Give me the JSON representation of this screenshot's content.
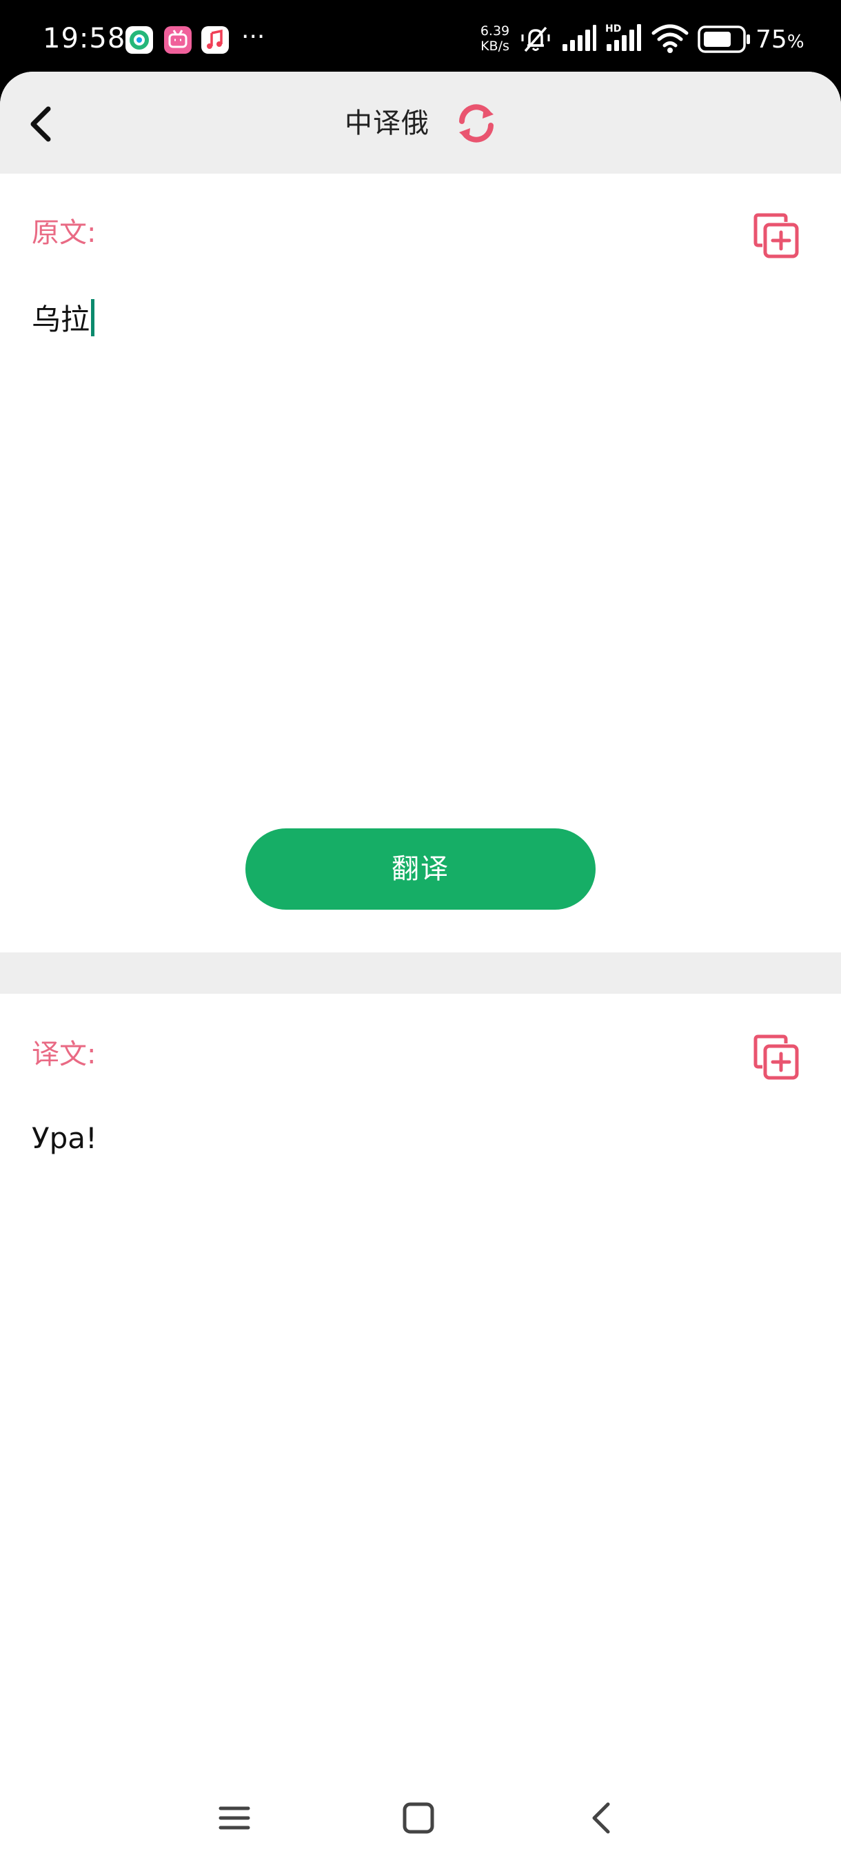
{
  "status_bar": {
    "time": "19:58",
    "more": "···",
    "net_speed_value": "6.39",
    "net_speed_unit": "KB/s",
    "hd_label": "HD",
    "battery_value": "75",
    "battery_unit": "%",
    "battery_level": 0.75,
    "app_icons": [
      "qq-icon",
      "bilibili-icon",
      "music-icon"
    ]
  },
  "header": {
    "title": "中译俄",
    "back_icon": "chevron-left-icon",
    "swap_icon": "swap-refresh-icon"
  },
  "source": {
    "label": "原文:",
    "text": "乌拉",
    "copy_icon": "copy-plus-icon"
  },
  "translate_button": {
    "label": "翻译"
  },
  "result": {
    "label": "译文:",
    "text": "Ура!",
    "copy_icon": "copy-plus-icon"
  },
  "nav_bar": {
    "icons": [
      "menu-icon",
      "home-icon",
      "back-icon"
    ]
  },
  "colors": {
    "accent": "#e96a84",
    "button": "#16ae66",
    "caret": "#0b8a6d",
    "header_bg": "#eeeeee"
  }
}
